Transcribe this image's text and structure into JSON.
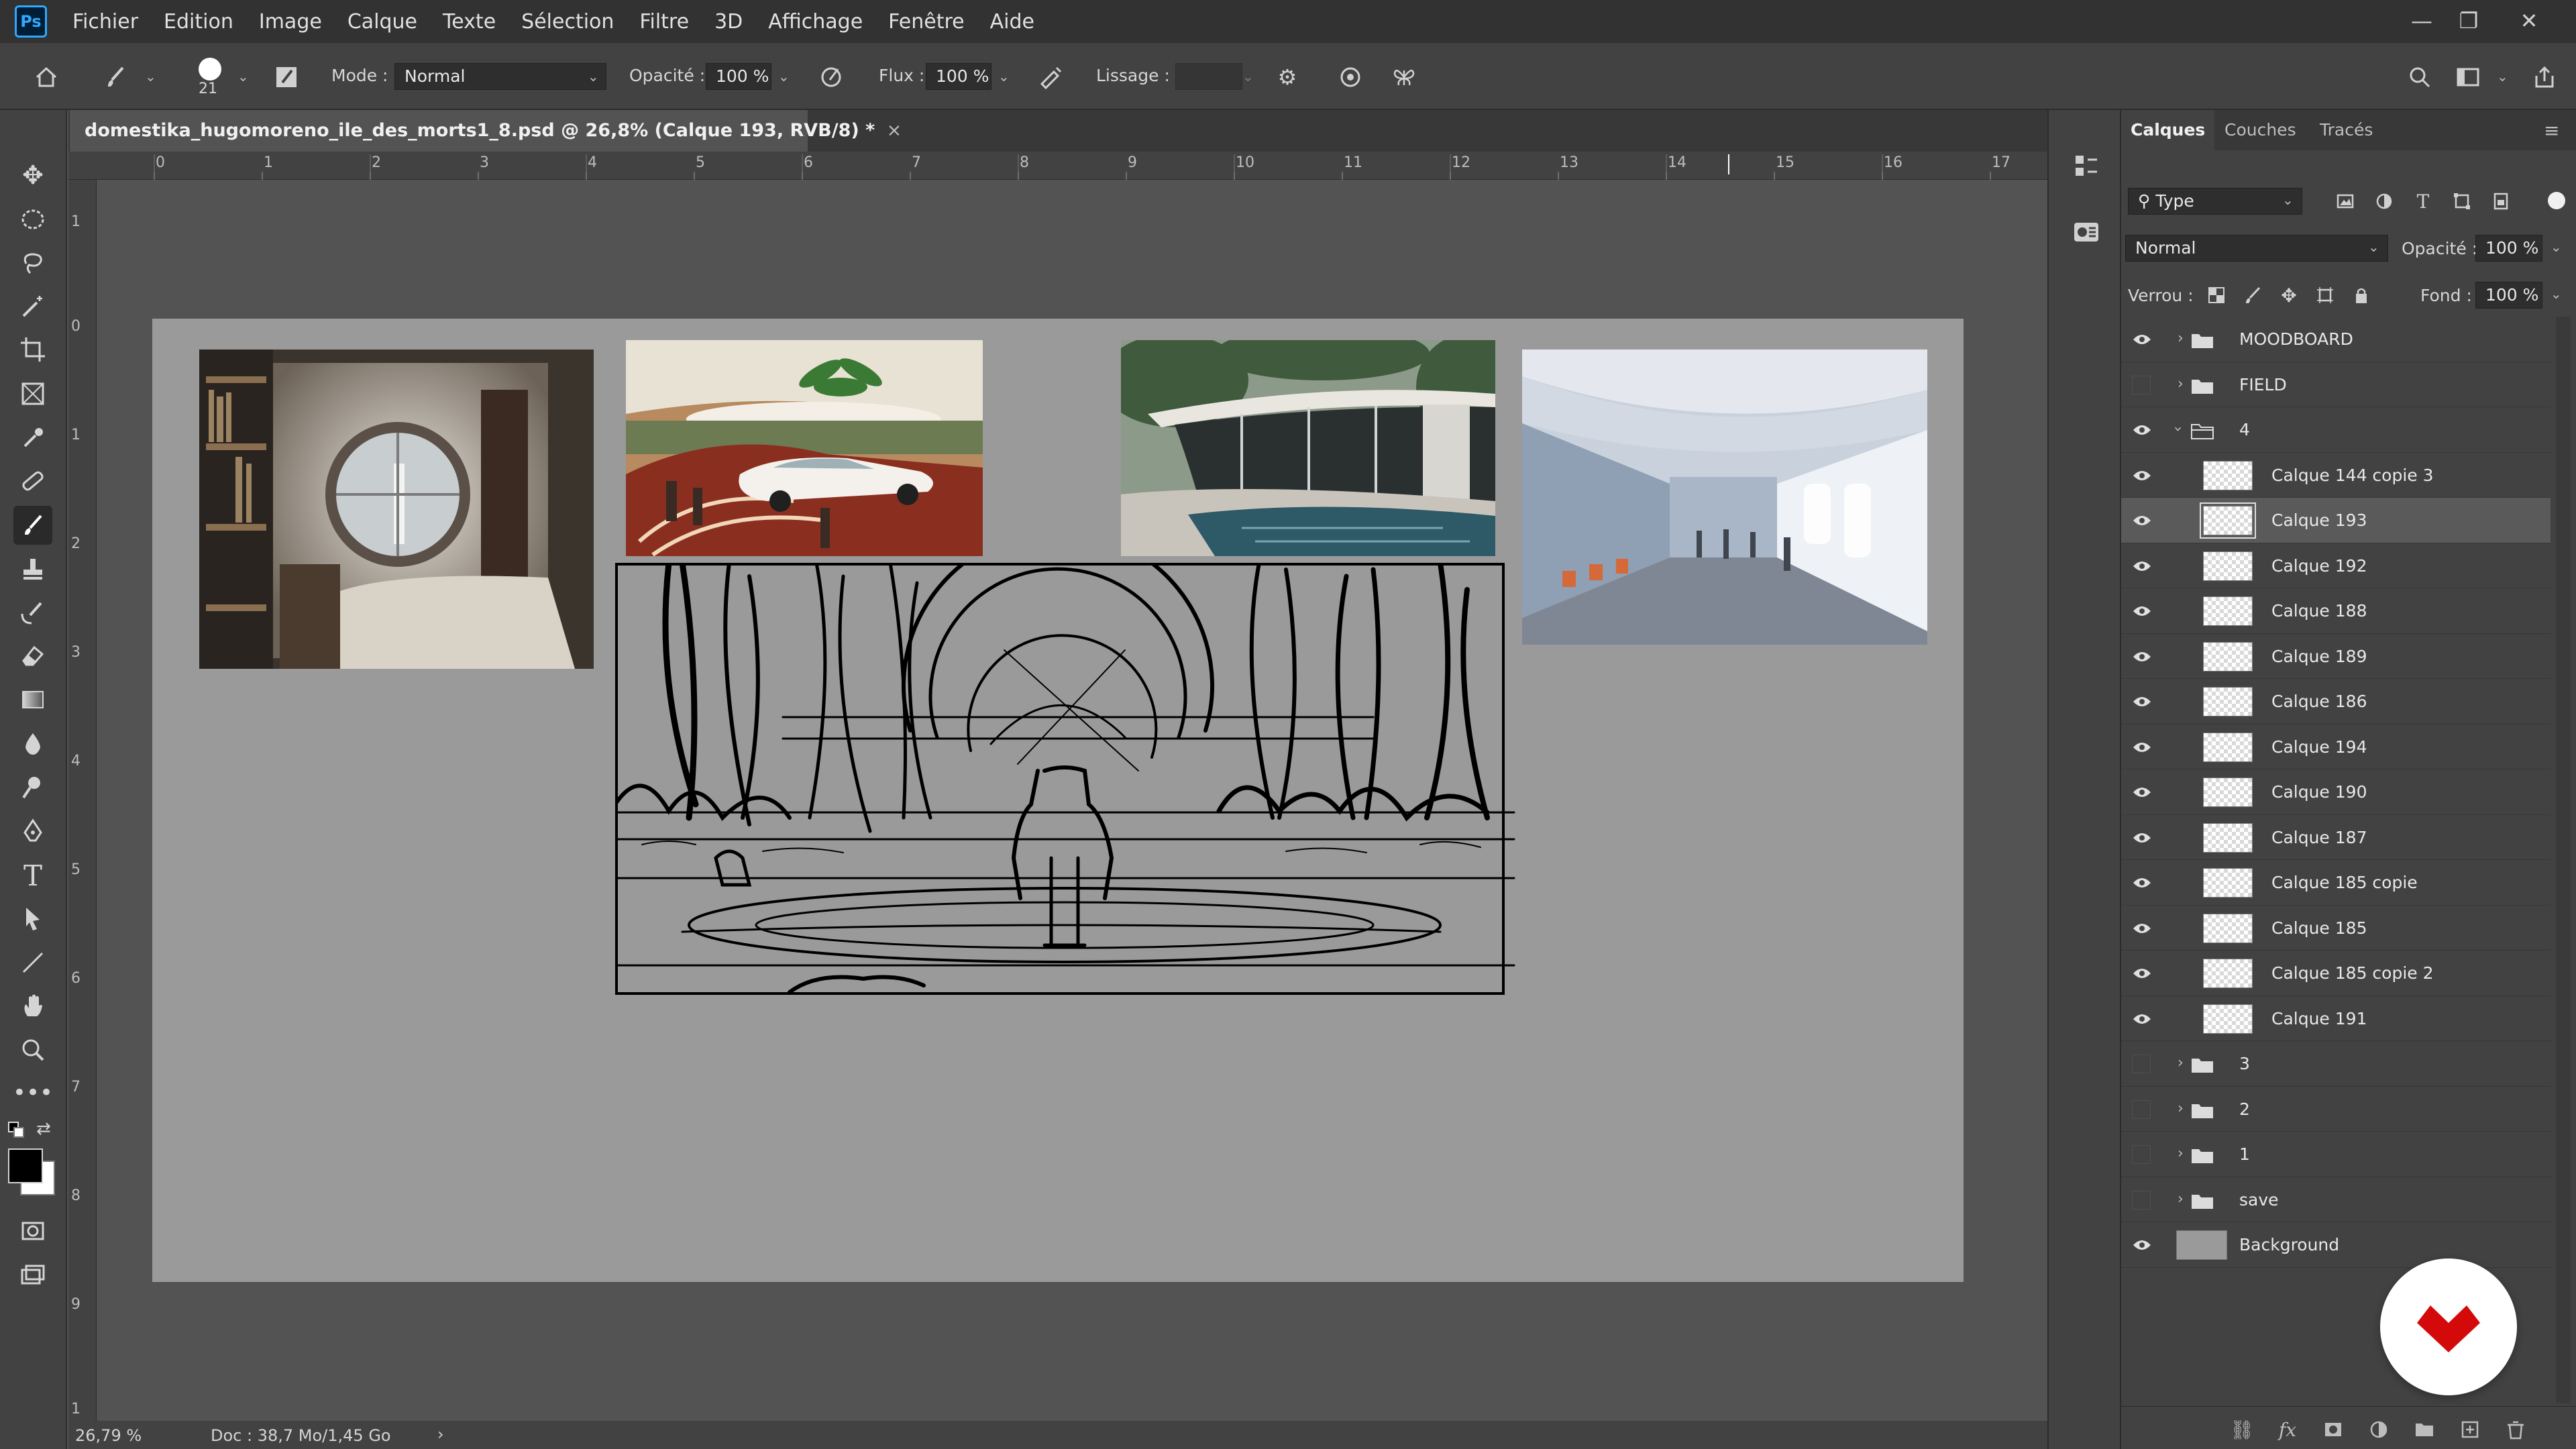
{
  "app": {
    "logo": "Ps",
    "menu": [
      "Fichier",
      "Edition",
      "Image",
      "Calque",
      "Texte",
      "Sélection",
      "Filtre",
      "3D",
      "Affichage",
      "Fenêtre",
      "Aide"
    ]
  },
  "options": {
    "brush_size": "21",
    "mode_label": "Mode :",
    "mode_value": "Normal",
    "opacity_label": "Opacité :",
    "opacity_value": "100 %",
    "flow_label": "Flux :",
    "flow_value": "100 %",
    "smoothing_label": "Lissage :",
    "smoothing_value": ""
  },
  "document": {
    "tab_title": "domestika_hugomoreno_ile_des_morts1_8.psd @ 26,8% (Calque 193, RVB/8) *",
    "close_glyph": "×"
  },
  "ruler": {
    "h": [
      "0",
      "1",
      "2",
      "3",
      "4",
      "5",
      "6",
      "7",
      "8",
      "9",
      "10",
      "11",
      "12",
      "13",
      "14",
      "15",
      "16",
      "17"
    ],
    "v": [
      "1",
      "0",
      "1",
      "2",
      "3",
      "4",
      "5",
      "6",
      "7",
      "8",
      "9",
      "1"
    ]
  },
  "status": {
    "zoom": "26,79 %",
    "doc": "Doc : 38,7 Mo/1,45 Go",
    "arrow": "›"
  },
  "panel": {
    "tabs": [
      "Calques",
      "Couches",
      "Tracés"
    ],
    "filter_value": "Type",
    "blend_value": "Normal",
    "opacity_label": "Opacité :",
    "opacity_value": "100 %",
    "lock_label": "Verrou :",
    "fill_label": "Fond :",
    "fill_value": "100 %"
  },
  "layers": [
    {
      "name": "MOODBOARD",
      "type": "group",
      "visible": true,
      "expanded": false
    },
    {
      "name": "FIELD",
      "type": "group",
      "visible": false,
      "expanded": false
    },
    {
      "name": "4",
      "type": "group",
      "visible": true,
      "expanded": true
    },
    {
      "name": "Calque 144 copie 3",
      "type": "layer",
      "visible": true,
      "selected": false
    },
    {
      "name": "Calque 193",
      "type": "layer",
      "visible": true,
      "selected": true
    },
    {
      "name": "Calque 192",
      "type": "layer",
      "visible": true,
      "selected": false
    },
    {
      "name": "Calque 188",
      "type": "layer",
      "visible": true,
      "selected": false
    },
    {
      "name": "Calque 189",
      "type": "layer",
      "visible": true,
      "selected": false
    },
    {
      "name": "Calque 186",
      "type": "layer",
      "visible": true,
      "selected": false
    },
    {
      "name": "Calque 194",
      "type": "layer",
      "visible": true,
      "selected": false
    },
    {
      "name": "Calque 190",
      "type": "layer",
      "visible": true,
      "selected": false
    },
    {
      "name": "Calque 187",
      "type": "layer",
      "visible": true,
      "selected": false
    },
    {
      "name": "Calque 185 copie",
      "type": "layer",
      "visible": true,
      "selected": false
    },
    {
      "name": "Calque 185",
      "type": "layer",
      "visible": true,
      "selected": false
    },
    {
      "name": "Calque 185 copie 2",
      "type": "layer",
      "visible": true,
      "selected": false
    },
    {
      "name": "Calque 191",
      "type": "layer",
      "visible": true,
      "selected": false
    },
    {
      "name": "3",
      "type": "group",
      "visible": false,
      "expanded": false
    },
    {
      "name": "2",
      "type": "group",
      "visible": false,
      "expanded": false
    },
    {
      "name": "1",
      "type": "group",
      "visible": false,
      "expanded": false
    },
    {
      "name": "save",
      "type": "group",
      "visible": false,
      "expanded": false
    },
    {
      "name": "Background",
      "type": "background",
      "visible": true,
      "selected": false
    }
  ],
  "colors": {
    "accent": "#31a8ff",
    "brand_badge": "#d40a0a"
  }
}
